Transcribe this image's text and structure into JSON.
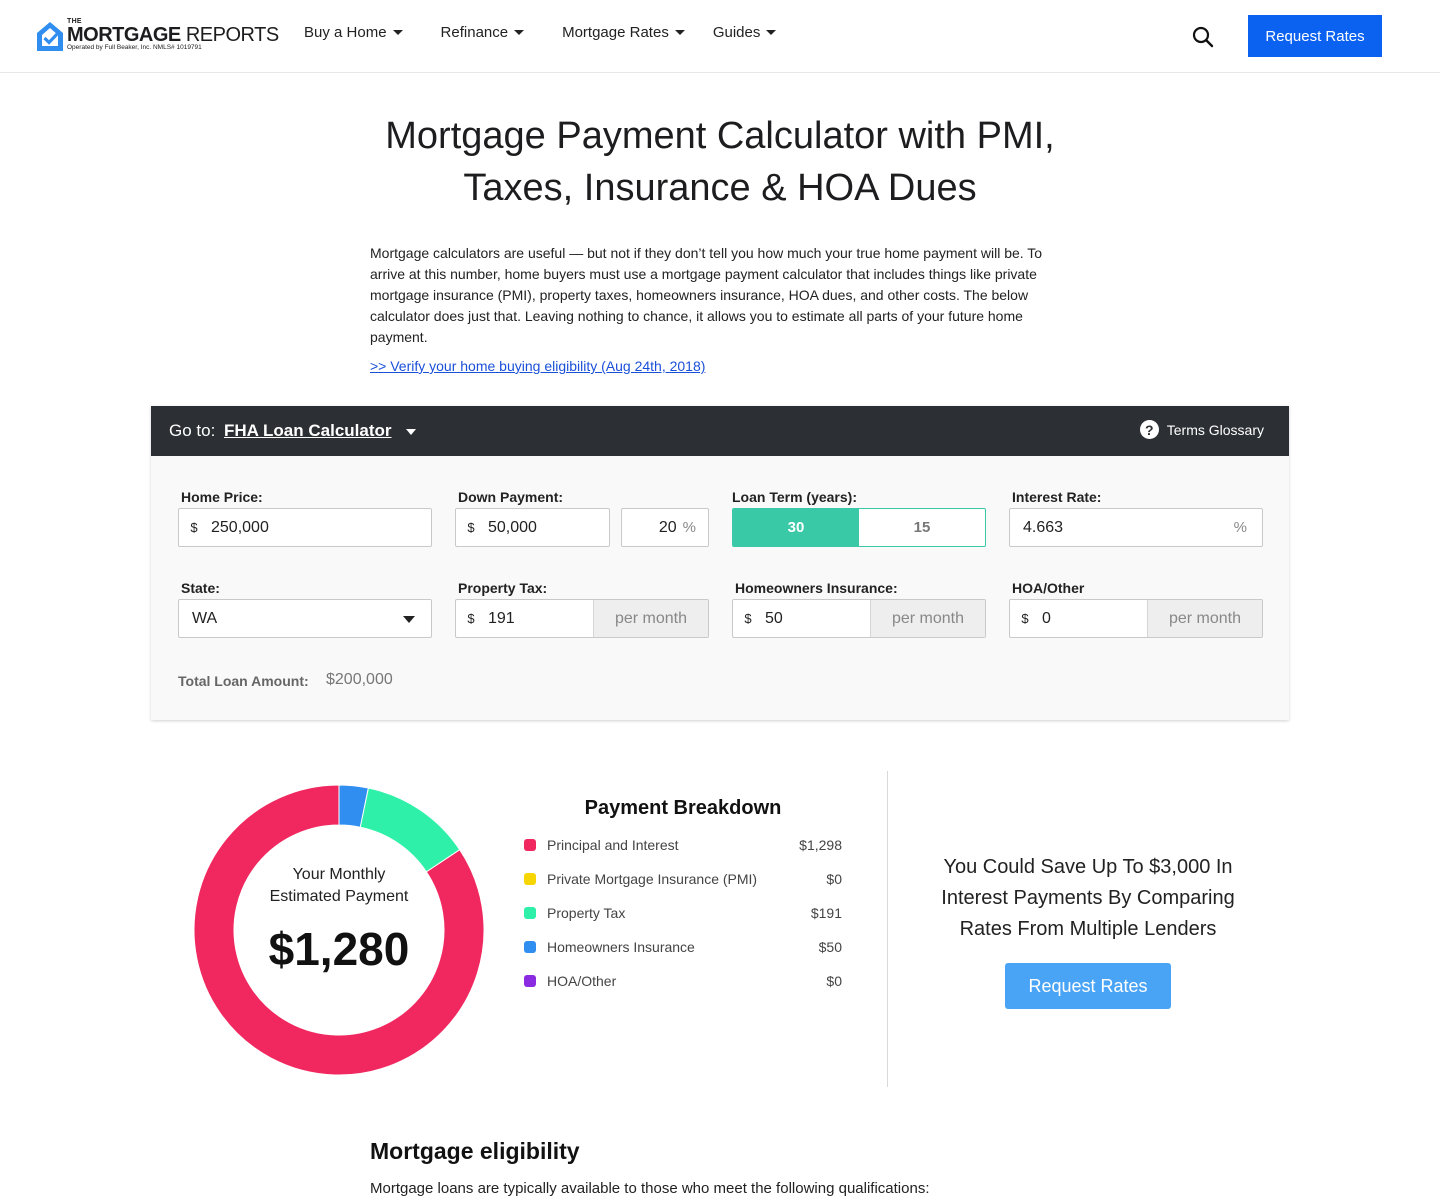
{
  "header": {
    "logo": {
      "the": "THE",
      "brand_bold": "MORTGAGE",
      "brand_light": "REPORTS",
      "sub": "Operated by Full Beaker, Inc. NMLS# 1019791"
    },
    "nav": [
      {
        "label": "Buy a Home"
      },
      {
        "label": "Refinance"
      },
      {
        "label": "Mortgage Rates"
      },
      {
        "label": "Guides"
      }
    ],
    "search_icon": "search-icon",
    "request_button": "Request Rates",
    "accent_color": "#0b62f0"
  },
  "page": {
    "title_line1": "Mortgage Payment Calculator with PMI,",
    "title_line2": "Taxes, Insurance & HOA Dues",
    "intro": "Mortgage calculators are useful — but not if they don’t tell you how much your true home payment will be. To arrive at this number, home buyers must use a mortgage payment calculator that includes things like private mortgage insurance (PMI), property taxes, homeowners insurance, HOA dues, and other costs.  The below calculator does just that. Leaving nothing to chance, it allows you to estimate all parts of your future home payment.",
    "verify_link": ">> Verify your home buying eligibility (Aug 24th, 2018)"
  },
  "calculator": {
    "goto_label": "Go to:",
    "goto_value": "FHA Loan Calculator",
    "glossary": "Terms Glossary",
    "home_price": {
      "label": "Home Price:",
      "prefix": "$",
      "value": "250,000"
    },
    "down_payment": {
      "label": "Down Payment:",
      "prefix": "$",
      "value": "50,000",
      "percent": "20",
      "percent_sign": "%"
    },
    "loan_term": {
      "label": "Loan Term (years):",
      "options": [
        "30",
        "15"
      ],
      "selected": "30",
      "active_color": "#3ac9a7"
    },
    "interest_rate": {
      "label": "Interest Rate:",
      "value": "4.663",
      "suffix": "%"
    },
    "state": {
      "label": "State:",
      "value": "WA"
    },
    "property_tax": {
      "label": "Property Tax:",
      "prefix": "$",
      "value": "191",
      "suffix": "per month"
    },
    "homeowners_insurance": {
      "label": "Homeowners Insurance:",
      "prefix": "$",
      "value": "50",
      "suffix": "per month"
    },
    "hoa": {
      "label": "HOA/Other",
      "prefix": "$",
      "value": "0",
      "suffix": "per month"
    },
    "total_loan_label": "Total Loan Amount:",
    "total_loan_value": "$200,000"
  },
  "results": {
    "center_label_line1": "Your Monthly",
    "center_label_line2": "Estimated Payment",
    "monthly_payment": "$1,280",
    "breakdown_title": "Payment Breakdown",
    "breakdown": [
      {
        "label": "Principal and Interest",
        "value": "$1,298",
        "amount": 1298,
        "color": "#f0285f"
      },
      {
        "label": "Private Mortgage Insurance (PMI)",
        "value": "$0",
        "amount": 0,
        "color": "#f7d500"
      },
      {
        "label": "Property Tax",
        "value": "$191",
        "amount": 191,
        "color": "#2ef0a8"
      },
      {
        "label": "Homeowners Insurance",
        "value": "$50",
        "amount": 50,
        "color": "#2f8ef0"
      },
      {
        "label": "HOA/Other",
        "value": "$0",
        "amount": 0,
        "color": "#8a2be2"
      }
    ],
    "save_text": "You Could Save Up To $3,000 In Interest Payments By Comparing Rates From Multiple Lenders",
    "request_button": "Request Rates"
  },
  "eligibility": {
    "title": "Mortgage eligibility",
    "text": "Mortgage loans are typically available to those who meet the following qualifications:"
  }
}
